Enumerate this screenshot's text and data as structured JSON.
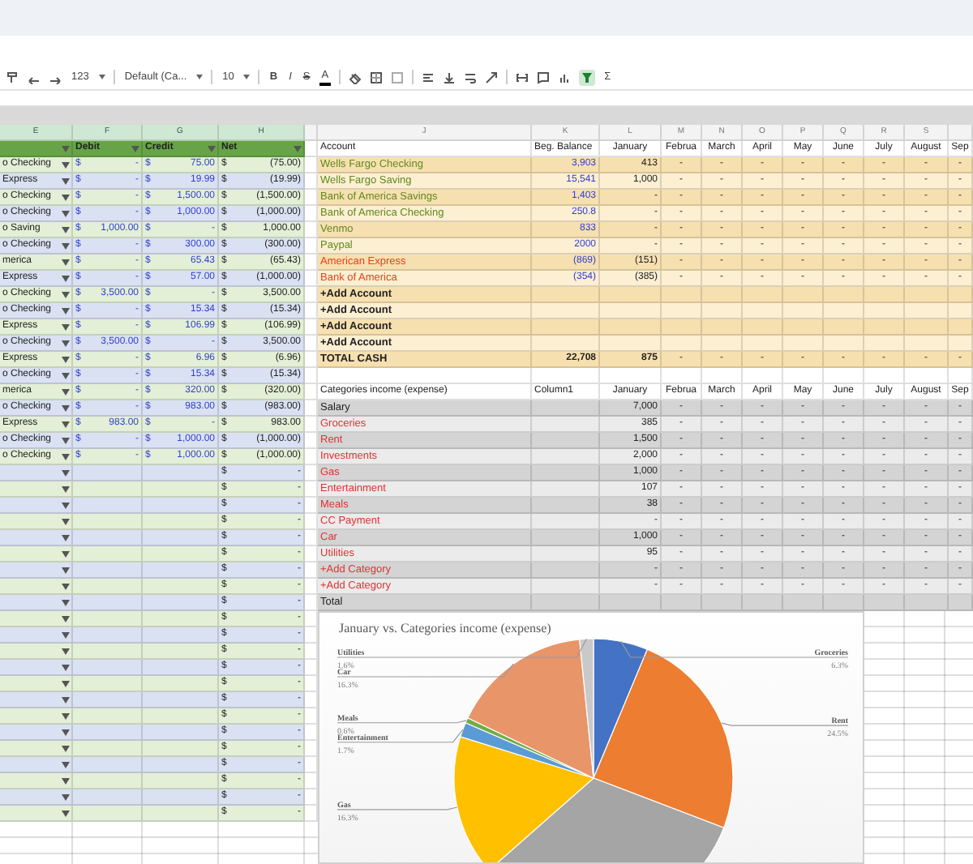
{
  "toolbar": {
    "number_format": "123",
    "font": "Default (Ca...",
    "size": "10",
    "bold": "B",
    "italic": "I",
    "strike": "S",
    "text_color": "A",
    "sum": "Σ",
    "filter_active": true
  },
  "left_letters": [
    {
      "letter": "E",
      "selected": true
    },
    {
      "letter": "F",
      "selected": true
    },
    {
      "letter": "G",
      "selected": true
    },
    {
      "letter": "H",
      "selected": true
    }
  ],
  "right_letters": [
    {
      "letter": "J",
      "selected": false
    },
    {
      "letter": "K",
      "selected": false
    },
    {
      "letter": "L",
      "selected": false
    },
    {
      "letter": "M",
      "selected": false
    },
    {
      "letter": "N",
      "selected": false
    },
    {
      "letter": "O",
      "selected": false
    },
    {
      "letter": "P",
      "selected": false
    },
    {
      "letter": "Q",
      "selected": false
    },
    {
      "letter": "R",
      "selected": false
    },
    {
      "letter": "S",
      "selected": false
    }
  ],
  "ledger": {
    "headers": [
      "Debit",
      "Credit",
      "Net"
    ],
    "rows": [
      {
        "account": "o Checking",
        "debit": [
          "$",
          "-"
        ],
        "credit": [
          "$",
          "75.00"
        ],
        "net": [
          "$",
          "(75.00)"
        ]
      },
      {
        "account": "Express",
        "debit": [
          "$",
          "-"
        ],
        "credit": [
          "$",
          "19.99"
        ],
        "net": [
          "$",
          "(19.99)"
        ]
      },
      {
        "account": "o Checking",
        "debit": [
          "$",
          "-"
        ],
        "credit": [
          "$",
          "1,500.00"
        ],
        "net": [
          "$",
          "(1,500.00)"
        ]
      },
      {
        "account": "o Checking",
        "debit": [
          "$",
          "-"
        ],
        "credit": [
          "$",
          "1,000.00"
        ],
        "net": [
          "$",
          "(1,000.00)"
        ]
      },
      {
        "account": "o Saving",
        "debit": [
          "$",
          "1,000.00"
        ],
        "credit": [
          "$",
          "-"
        ],
        "net": [
          "$",
          "1,000.00"
        ]
      },
      {
        "account": "o Checking",
        "debit": [
          "$",
          "-"
        ],
        "credit": [
          "$",
          "300.00"
        ],
        "net": [
          "$",
          "(300.00)"
        ]
      },
      {
        "account": "merica",
        "debit": [
          "$",
          "-"
        ],
        "credit": [
          "$",
          "65.43"
        ],
        "net": [
          "$",
          "(65.43)"
        ]
      },
      {
        "account": "Express",
        "debit": [
          "$",
          "-"
        ],
        "credit": [
          "$",
          "57.00"
        ],
        "net": [
          "$",
          "(1,000.00)"
        ]
      },
      {
        "account": "o Checking",
        "debit": [
          "$",
          "3,500.00"
        ],
        "credit": [
          "$",
          "-"
        ],
        "net": [
          "$",
          "3,500.00"
        ]
      },
      {
        "account": "o Checking",
        "debit": [
          "$",
          "-"
        ],
        "credit": [
          "$",
          "15.34"
        ],
        "net": [
          "$",
          "(15.34)"
        ]
      },
      {
        "account": "Express",
        "debit": [
          "$",
          "-"
        ],
        "credit": [
          "$",
          "106.99"
        ],
        "net": [
          "$",
          "(106.99)"
        ]
      },
      {
        "account": "o Checking",
        "debit": [
          "$",
          "3,500.00"
        ],
        "credit": [
          "$",
          "-"
        ],
        "net": [
          "$",
          "3,500.00"
        ]
      },
      {
        "account": "Express",
        "debit": [
          "$",
          "-"
        ],
        "credit": [
          "$",
          "6.96"
        ],
        "net": [
          "$",
          "(6.96)"
        ]
      },
      {
        "account": "o Checking",
        "debit": [
          "$",
          "-"
        ],
        "credit": [
          "$",
          "15.34"
        ],
        "net": [
          "$",
          "(15.34)"
        ]
      },
      {
        "account": "merica",
        "debit": [
          "$",
          "-"
        ],
        "credit": [
          "$",
          "320.00"
        ],
        "net": [
          "$",
          "(320.00)"
        ]
      },
      {
        "account": "o Checking",
        "debit": [
          "$",
          "-"
        ],
        "credit": [
          "$",
          "983.00"
        ],
        "net": [
          "$",
          "(983.00)"
        ]
      },
      {
        "account": "Express",
        "debit": [
          "$",
          "983.00"
        ],
        "credit": [
          "$",
          "-"
        ],
        "net": [
          "$",
          "983.00"
        ]
      },
      {
        "account": "o Checking",
        "debit": [
          "$",
          "-"
        ],
        "credit": [
          "$",
          "1,000.00"
        ],
        "net": [
          "$",
          "(1,000.00)"
        ]
      },
      {
        "account": "o Checking",
        "debit": [
          "$",
          "-"
        ],
        "credit": [
          "$",
          "1,000.00"
        ],
        "net": [
          "$",
          "(1,000.00)"
        ]
      },
      {
        "net": [
          "$",
          "-"
        ]
      },
      {
        "net": [
          "$",
          "-"
        ]
      },
      {
        "net": [
          "$",
          "-"
        ]
      },
      {
        "net": [
          "$",
          "-"
        ]
      },
      {
        "net": [
          "$",
          "-"
        ]
      },
      {
        "net": [
          "$",
          "-"
        ]
      },
      {
        "net": [
          "$",
          "-"
        ]
      },
      {
        "net": [
          "$",
          "-"
        ]
      },
      {
        "net": [
          "$",
          "-"
        ]
      },
      {
        "net": [
          "$",
          "-"
        ]
      },
      {
        "net": [
          "$",
          "-"
        ]
      },
      {
        "net": [
          "$",
          "-"
        ]
      },
      {
        "net": [
          "$",
          "-"
        ]
      },
      {
        "net": [
          "$",
          "-"
        ]
      },
      {
        "net": [
          "$",
          "-"
        ]
      },
      {
        "net": [
          "$",
          "-"
        ]
      },
      {
        "net": [
          "$",
          "-"
        ]
      },
      {
        "net": [
          "$",
          "-"
        ]
      },
      {
        "net": [
          "$",
          "-"
        ]
      },
      {
        "net": [
          "$",
          "-"
        ]
      },
      {
        "net": [
          "$",
          "-"
        ]
      },
      {
        "net": [
          "$",
          "-"
        ]
      }
    ]
  },
  "accounts": {
    "headers": [
      "Account",
      "Beg. Balance",
      "January",
      "Februa",
      "March",
      "April",
      "May",
      "June",
      "July",
      "August",
      "Sep"
    ],
    "rows": [
      {
        "kind": "account",
        "name": "Wells Fargo Checking",
        "color": "#5f8a1e",
        "balance": "3,903",
        "january": "413",
        "months": [
          "-",
          "-",
          "-",
          "-",
          "-",
          "-",
          "-",
          "-"
        ]
      },
      {
        "kind": "account",
        "name": "Wells Fargo Saving",
        "color": "#5f8a1e",
        "balance": "15,541",
        "january": "1,000",
        "months": [
          "-",
          "-",
          "-",
          "-",
          "-",
          "-",
          "-",
          "-"
        ]
      },
      {
        "kind": "account",
        "name": "Bank of America Savings",
        "color": "#5f8a1e",
        "balance": "1,403",
        "january": "-",
        "months": [
          "-",
          "-",
          "-",
          "-",
          "-",
          "-",
          "-",
          "-"
        ]
      },
      {
        "kind": "account",
        "name": "Bank of America Checking",
        "color": "#5f8a1e",
        "balance": "250.8",
        "january": "-",
        "months": [
          "-",
          "-",
          "-",
          "-",
          "-",
          "-",
          "-",
          "-"
        ]
      },
      {
        "kind": "account",
        "name": "Venmo",
        "color": "#5f8a1e",
        "balance": "833",
        "january": "-",
        "months": [
          "-",
          "-",
          "-",
          "-",
          "-",
          "-",
          "-",
          "-"
        ]
      },
      {
        "kind": "account",
        "name": "Paypal",
        "color": "#5f8a1e",
        "balance": "2000",
        "january": "-",
        "months": [
          "-",
          "-",
          "-",
          "-",
          "-",
          "-",
          "-",
          "-"
        ]
      },
      {
        "kind": "account",
        "name": "American Express",
        "color": "#e8401c",
        "balance": "(869)",
        "january": "(151)",
        "months": [
          "-",
          "-",
          "-",
          "-",
          "-",
          "-",
          "-",
          "-"
        ]
      },
      {
        "kind": "account",
        "name": "Bank of America",
        "color": "#e8401c",
        "balance": "(354)",
        "january": "(385)",
        "months": [
          "-",
          "-",
          "-",
          "-",
          "-",
          "-",
          "-",
          "-"
        ]
      },
      {
        "kind": "add",
        "name": "+Add Account",
        "color": "#222222"
      },
      {
        "kind": "add",
        "name": "+Add Account",
        "color": "#222222"
      },
      {
        "kind": "add",
        "name": "+Add Account",
        "color": "#222222"
      },
      {
        "kind": "add",
        "name": "+Add Account",
        "color": "#222222"
      },
      {
        "kind": "total",
        "name": "TOTAL CASH",
        "color": "#222222",
        "balance": "22,708",
        "january": "875",
        "months": [
          "-",
          "-",
          "-",
          "-",
          "-",
          "-",
          "-",
          "-"
        ]
      }
    ]
  },
  "categories": {
    "headers": [
      "Categories income (expense)",
      "Column1",
      "January",
      "Februa",
      "March",
      "April",
      "May",
      "June",
      "July",
      "August",
      "Sep"
    ],
    "rows": [
      {
        "name": "Salary",
        "color": "#222222",
        "january": "7,000",
        "months": [
          "-",
          "-",
          "-",
          "-",
          "-",
          "-",
          "-",
          "-"
        ]
      },
      {
        "name": "Groceries",
        "color": "#e03131",
        "january": "385",
        "months": [
          "-",
          "-",
          "-",
          "-",
          "-",
          "-",
          "-",
          "-"
        ]
      },
      {
        "name": "Rent",
        "color": "#e03131",
        "january": "1,500",
        "months": [
          "-",
          "-",
          "-",
          "-",
          "-",
          "-",
          "-",
          "-"
        ]
      },
      {
        "name": "Investments",
        "color": "#e03131",
        "january": "2,000",
        "months": [
          "-",
          "-",
          "-",
          "-",
          "-",
          "-",
          "-",
          "-"
        ]
      },
      {
        "name": "Gas",
        "color": "#e03131",
        "january": "1,000",
        "months": [
          "-",
          "-",
          "-",
          "-",
          "-",
          "-",
          "-",
          "-"
        ]
      },
      {
        "name": "Entertainment",
        "color": "#e03131",
        "january": "107",
        "months": [
          "-",
          "-",
          "-",
          "-",
          "-",
          "-",
          "-",
          "-"
        ]
      },
      {
        "name": "Meals",
        "color": "#e03131",
        "january": "38",
        "months": [
          "-",
          "-",
          "-",
          "-",
          "-",
          "-",
          "-",
          "-"
        ]
      },
      {
        "name": "CC Payment",
        "color": "#e03131",
        "january": "-",
        "months": [
          "-",
          "-",
          "-",
          "-",
          "-",
          "-",
          "-",
          "-"
        ]
      },
      {
        "name": "Car",
        "color": "#e03131",
        "january": "1,000",
        "months": [
          "-",
          "-",
          "-",
          "-",
          "-",
          "-",
          "-",
          "-"
        ]
      },
      {
        "name": "Utilities",
        "color": "#e03131",
        "january": "95",
        "months": [
          "-",
          "-",
          "-",
          "-",
          "-",
          "-",
          "-",
          "-"
        ]
      },
      {
        "name": "+Add Category",
        "color": "#e03131",
        "january": "-",
        "months": [
          "-",
          "-",
          "-",
          "-",
          "-",
          "-",
          "-",
          "-"
        ]
      },
      {
        "name": "+Add Category",
        "color": "#e03131",
        "january": "-",
        "months": [
          "-",
          "-",
          "-",
          "-",
          "-",
          "-",
          "-",
          "-"
        ]
      },
      {
        "name": "Total",
        "color": "#222222"
      }
    ]
  },
  "chart": {
    "chart_data": {
      "type": "pie",
      "title": "January vs. Categories income (expense)",
      "categories": [
        "Groceries",
        "Rent",
        null,
        "Gas",
        "Entertainment",
        "Meals",
        "Car",
        "Utilities"
      ],
      "values": [
        6.3,
        24.5,
        32.7,
        16.3,
        1.7,
        0.6,
        16.3,
        1.6
      ],
      "colors": [
        "#4472c4",
        "#ed7d31",
        "#a5a5a5",
        "#ffc000",
        "#5b9bd5",
        "#70ad47",
        "#e8956a",
        "#c9c9c9"
      ],
      "value_labels": [
        "6.3%",
        "24.5%",
        null,
        "16.3%",
        "1.7%",
        "0.6%",
        "16.3%",
        "1.6%"
      ]
    }
  }
}
